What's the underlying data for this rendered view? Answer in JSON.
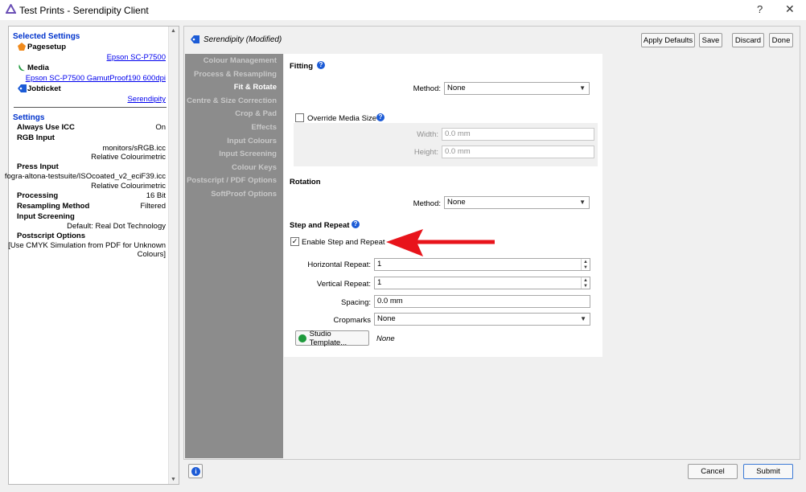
{
  "window": {
    "title": "Test Prints - Serendipity Client",
    "help_glyph": "?",
    "close_glyph": "✕"
  },
  "left_panel": {
    "selected_heading": "Selected Settings",
    "pagesetup_label": "Pagesetup",
    "pagesetup_value": "Epson SC-P7500",
    "media_label": "Media",
    "media_value": "Epson SC-P7500 GamutProof190 600dpi",
    "jobticket_label": "Jobticket",
    "jobticket_value": "Serendipity",
    "settings_heading": "Settings",
    "always_icc_label": "Always Use ICC",
    "always_icc_value": "On",
    "rgb_input_label": "RGB Input",
    "rgb_input_value1": "monitors/sRGB.icc",
    "rgb_input_value2": "Relative Colourimetric",
    "press_input_label": "Press Input",
    "press_input_value1": "fogra-altona-testsuite/ISOcoated_v2_eciF39.icc",
    "press_input_value2": "Relative Colourimetric",
    "processing_label": "Processing",
    "processing_value": "16 Bit",
    "resampling_label": "Resampling Method",
    "resampling_value": "Filtered",
    "screening_label": "Input Screening",
    "screening_value": "Default: Real Dot Technology",
    "postscript_label": "Postscript Options",
    "postscript_value1": "[Use CMYK Simulation from PDF for Unknown",
    "postscript_value2": "Colours]"
  },
  "header": {
    "title": "Serendipity (Modified)",
    "apply_defaults": "Apply Defaults",
    "save": "Save",
    "discard": "Discard",
    "done": "Done"
  },
  "nav": {
    "items": [
      "Colour Management",
      "Process & Resampling",
      "Fit & Rotate",
      "Centre & Size Correction",
      "Crop & Pad",
      "Effects",
      "Input Colours",
      "Input Screening",
      "Colour Keys",
      "Postscript / PDF Options",
      "SoftProof Options"
    ],
    "active": "Fit & Rotate"
  },
  "fitting": {
    "title": "Fitting",
    "method_label": "Method:",
    "method_value": "None",
    "override_label": "Override Media Size",
    "override_checked": false,
    "width_label": "Width:",
    "width_value": "0.0 mm",
    "height_label": "Height:",
    "height_value": "0.0 mm"
  },
  "rotation": {
    "title": "Rotation",
    "method_label": "Method:",
    "method_value": "None"
  },
  "step_repeat": {
    "title": "Step and Repeat",
    "enable_label": "Enable Step and Repeat",
    "enable_checked": true,
    "enable_check_glyph": "✓",
    "h_repeat_label": "Horizontal Repeat:",
    "h_repeat_value": "1",
    "v_repeat_label": "Vertical Repeat:",
    "v_repeat_value": "1",
    "spacing_label": "Spacing:",
    "spacing_value": "0.0 mm",
    "cropmarks_label": "Cropmarks",
    "cropmarks_value": "None",
    "studio_button": "Studio Template...",
    "studio_value": "None"
  },
  "footer": {
    "cancel": "Cancel",
    "submit": "Submit"
  },
  "colors": {
    "accent_blue": "#1c5bd6",
    "nav_bg": "#8c8c8c",
    "annotation_arrow": "#e8141b",
    "green_status": "#1e9a3c"
  }
}
